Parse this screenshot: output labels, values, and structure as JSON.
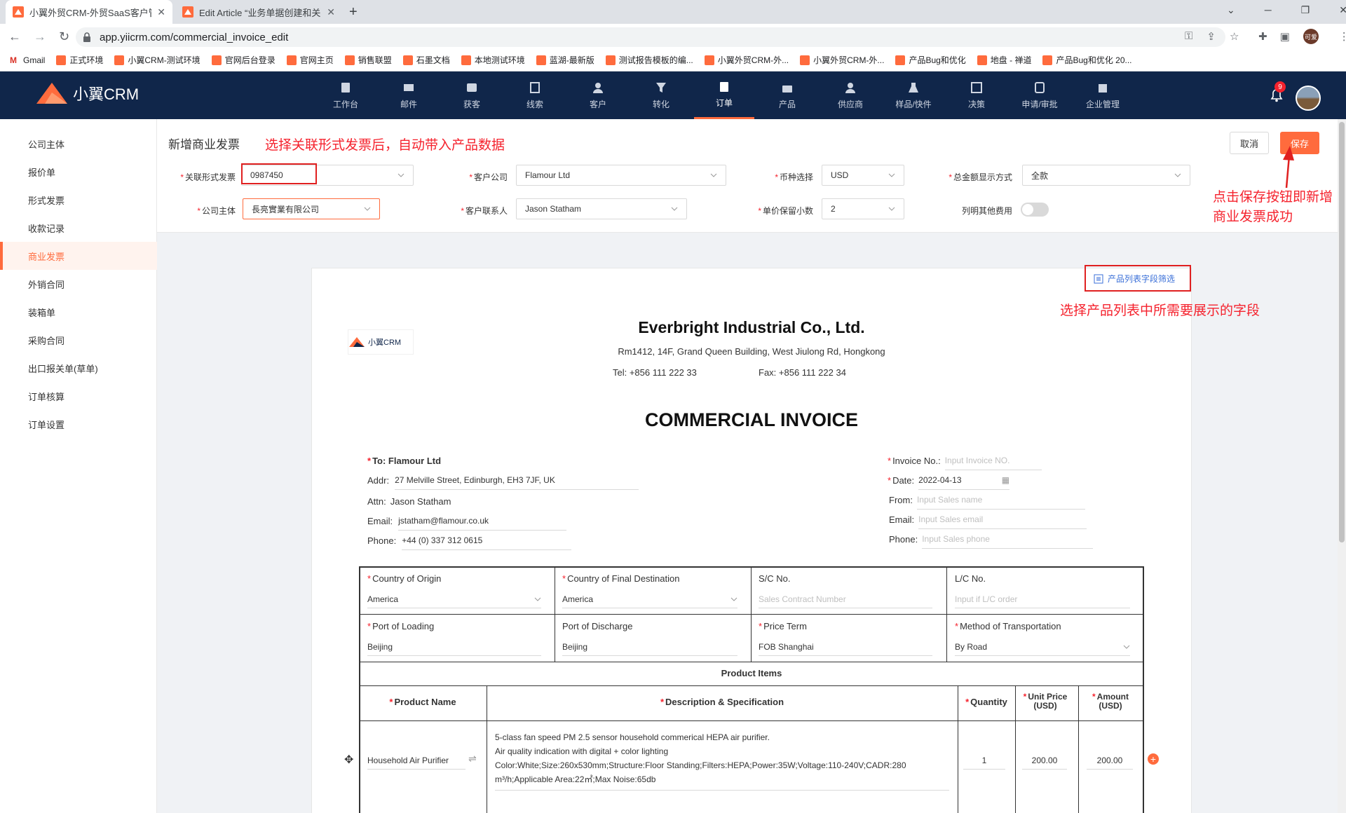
{
  "browser": {
    "tabs": [
      {
        "title": "小翼外贸CRM-外贸SaaS客户管理"
      },
      {
        "title": "Edit Article “业务单据创建和关联"
      }
    ],
    "new_tab": "+",
    "url": "app.yiicrm.com/commercial_invoice_edit",
    "bookmarks": [
      "Gmail",
      "正式环境",
      "小翼CRM-测试环境",
      "官网后台登录",
      "官网主页",
      "销售联盟",
      "石墨文档",
      "本地测试环境",
      "蓝湖-最新版",
      "测试报告模板的编...",
      "小翼外贸CRM-外...",
      "小翼外贸CRM-外...",
      "产品Bug和优化",
      "地盘 - 禅道",
      "产品Bug和优化 20..."
    ],
    "profile_label": "可爱"
  },
  "app": {
    "logo_text": "小翼CRM",
    "nav": [
      {
        "label": "工作台",
        "icon": "dashboard-icon"
      },
      {
        "label": "邮件",
        "icon": "mail-icon"
      },
      {
        "label": "获客",
        "icon": "acquire-icon"
      },
      {
        "label": "线索",
        "icon": "leads-icon"
      },
      {
        "label": "客户",
        "icon": "customer-icon"
      },
      {
        "label": "转化",
        "icon": "funnel-icon"
      },
      {
        "label": "订单",
        "icon": "order-icon",
        "active": true
      },
      {
        "label": "产品",
        "icon": "product-icon"
      },
      {
        "label": "供应商",
        "icon": "supplier-icon"
      },
      {
        "label": "样品/快件",
        "icon": "sample-icon"
      },
      {
        "label": "决策",
        "icon": "chart-icon"
      },
      {
        "label": "申请/审批",
        "icon": "approval-icon"
      },
      {
        "label": "企业管理",
        "icon": "company-icon"
      }
    ],
    "notification_count": "9"
  },
  "sidebar": [
    {
      "label": "公司主体"
    },
    {
      "label": "报价单"
    },
    {
      "label": "形式发票"
    },
    {
      "label": "收款记录"
    },
    {
      "label": "商业发票",
      "active": true
    },
    {
      "label": "外销合同"
    },
    {
      "label": "装箱单"
    },
    {
      "label": "采购合同"
    },
    {
      "label": "出口报关单(草单)"
    },
    {
      "label": "订单核算"
    },
    {
      "label": "订单设置"
    }
  ],
  "page": {
    "title": "新增商业发票",
    "annotation_main": "选择关联形式发票后，自动带入产品数据",
    "cancel": "取消",
    "save": "保存",
    "annotation_save": "点击保存按钮即新增商业发票成功",
    "annotation_fields": "选择产品列表中所需要展示的字段",
    "field_filter_button": "产品列表字段筛选"
  },
  "form": {
    "proforma_label": "关联形式发票",
    "proforma_value": "0987450",
    "company_label": "公司主体",
    "company_value": "長亮實業有限公司",
    "customer_label": "客户公司",
    "customer_value": "Flamour Ltd",
    "contact_label": "客户联系人",
    "contact_value": "Jason Statham",
    "currency_label": "币种选择",
    "currency_value": "USD",
    "decimals_label": "单价保留小数",
    "decimals_value": "2",
    "total_mode_label": "总金额显示方式",
    "total_mode_value": "全款",
    "other_fee_label": "列明其他费用"
  },
  "invoice": {
    "logo_text": "小翼CRM",
    "company_name": "Everbright Industrial Co., Ltd.",
    "address": "Rm1412, 14F, Grand Queen Building, West Jiulong Rd, Hongkong",
    "tel": "Tel: +856 111 222 33",
    "fax": "Fax: +856 111 222 34",
    "doc_title": "COMMERCIAL INVOICE",
    "to_label": "To: Flamour Ltd",
    "addr_label": "Addr:",
    "addr_value": "27 Melville Street, Edinburgh, EH3 7JF, UK",
    "attn_label": "Attn:",
    "attn_value": "Jason Statham",
    "email_label": "Email:",
    "email_value": "jstatham@flamour.co.uk",
    "phone_label": "Phone:",
    "phone_value": "+44 (0) 337 312 0615",
    "invoice_no_label": "Invoice No.:",
    "invoice_no_placeholder": "Input Invoice NO.",
    "date_label": "Date:",
    "date_value": "2022-04-13",
    "from_label": "From:",
    "from_placeholder": "Input Sales name",
    "s_email_label": "Email:",
    "s_email_placeholder": "Input Sales email",
    "s_phone_label": "Phone:",
    "s_phone_placeholder": "Input Sales phone",
    "origin_label": "Country of Origin",
    "origin_value": "America",
    "dest_label": "Country of Final Destination",
    "dest_value": "America",
    "sc_label": "S/C No.",
    "sc_placeholder": "Sales Contract Number",
    "lc_label": "L/C No.",
    "lc_placeholder": "Input if L/C order",
    "pol_label": "Port of Loading",
    "pol_value": "Beijing",
    "pod_label": "Port of Discharge",
    "pod_value": "Beijing",
    "price_term_label": "Price Term",
    "price_term_value": "FOB Shanghai",
    "transport_label": "Method of Transportation",
    "transport_value": "By Road",
    "product_items_label": "Product Items",
    "col_name": "Product Name",
    "col_desc": "Description & Specification",
    "col_qty": "Quantity",
    "col_price": "Unit Price (USD)",
    "col_amount": "Amount (USD)",
    "row_name": "Household Air Purifier",
    "row_desc1": "5-class fan speed PM 2.5 sensor household commerical HEPA air purifier.",
    "row_desc2": "Air quality indication with digital + color lighting",
    "row_desc3": "Color:White;Size:260x530mm;Structure:Floor Standing;Filters:HEPA;Power:35W;Voltage:110-240V;CADR:280",
    "row_desc4": "m³/h;Applicable Area:22㎡;Max Noise:65db",
    "row_qty": "1",
    "row_price": "200.00",
    "row_amount": "200.00"
  },
  "colors": {
    "accent": "#ff6b3d",
    "header": "#10264a",
    "annotation": "#e02020"
  }
}
